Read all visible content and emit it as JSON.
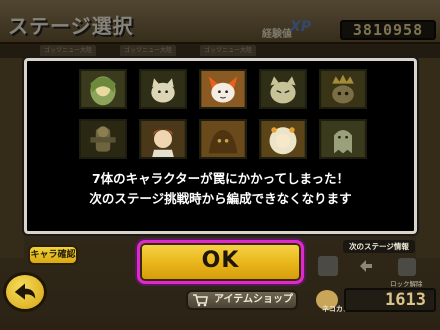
{
  "header": {
    "title": "ステージ選択",
    "xp_label": "経験値",
    "xp_badge": "XP",
    "xp_value": "3810958"
  },
  "background_tabs": [
    "ゴッヅニュー大陸",
    "ゴッヅニュー大陸",
    "ゴッヅニュー大陸"
  ],
  "dialog": {
    "characters": [
      {
        "icon": "girl-character-icon"
      },
      {
        "icon": "cat-character-icon"
      },
      {
        "icon": "red-cat-character-icon"
      },
      {
        "icon": "crazed-cat-character-icon"
      },
      {
        "icon": "crowned-cat-character-icon"
      },
      {
        "icon": "warrior-character-icon"
      },
      {
        "icon": "boy-character-icon"
      },
      {
        "icon": "dark-creature-character-icon"
      },
      {
        "icon": "white-haired-girl-character-icon"
      },
      {
        "icon": "ghost-character-icon"
      }
    ],
    "message_line1": "7体のキャラクターが罠にかかってしまった！",
    "message_line2": "次のステージ挑戦時から編成できなくなります"
  },
  "bottom": {
    "chara_confirm_label": "キャラ確認",
    "ok_label": "OK",
    "next_stage_info_label": "次のステージ情報",
    "lock_label": "ロック解除",
    "shop_label": "アイテムショップ",
    "neko_label": "ネコカン",
    "neko_value": "1613"
  },
  "colors": {
    "ok_border": "#e028d0",
    "ok_fill": "#e8b419",
    "dialog_border": "#d9d4c7"
  }
}
